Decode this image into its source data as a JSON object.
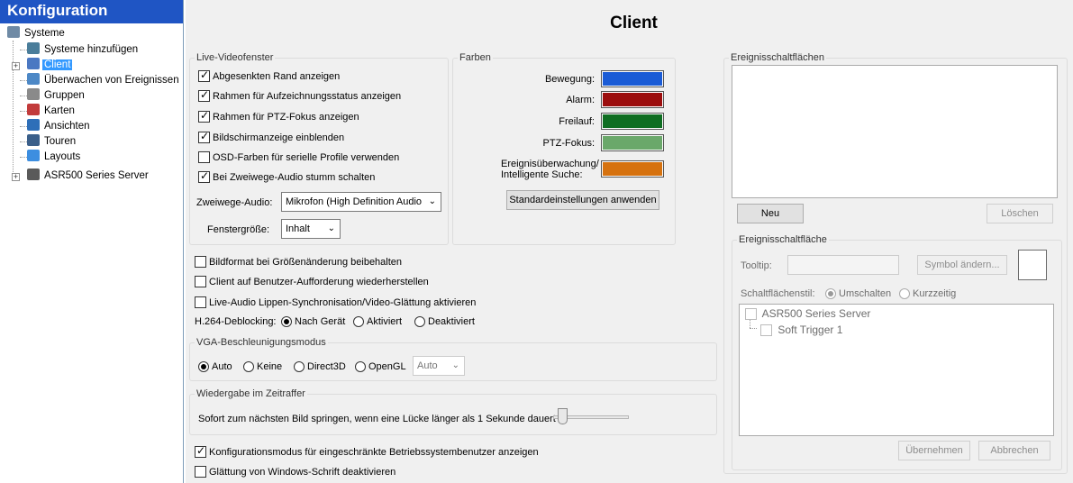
{
  "sidebar": {
    "title": "Konfiguration",
    "items": [
      {
        "label": "Systeme",
        "icon": "server-icon",
        "color": "#6f8aa5"
      },
      {
        "label": "Systeme hinzufügen",
        "icon": "add-system-icon",
        "color": "#4a7d9a"
      },
      {
        "label": "Client",
        "icon": "client-gear-icon",
        "color": "#4b78c2",
        "selected": true
      },
      {
        "label": "Überwachen von Ereignissen",
        "icon": "event-monitor-icon",
        "color": "#4d88c6"
      },
      {
        "label": "Gruppen",
        "icon": "groups-icon",
        "color": "#8a8a8a"
      },
      {
        "label": "Karten",
        "icon": "maps-icon",
        "color": "#c23b3b"
      },
      {
        "label": "Ansichten",
        "icon": "views-icon",
        "color": "#2e6fb8"
      },
      {
        "label": "Touren",
        "icon": "tours-icon",
        "color": "#3a5f8a"
      },
      {
        "label": "Layouts",
        "icon": "layouts-icon",
        "color": "#3d8ee0"
      },
      {
        "label": "ASR500 Series Server",
        "icon": "asr-server-icon",
        "color": "#5a5a5a"
      }
    ],
    "selected_color": "#3399ff",
    "header_color": "#1f55c4"
  },
  "main": {
    "title": "Client",
    "live": {
      "title": "Live-Videofenster",
      "checkboxes": [
        {
          "label": "Abgesenkten Rand anzeigen",
          "checked": true
        },
        {
          "label": "Rahmen für Aufzeichnungsstatus anzeigen",
          "checked": true
        },
        {
          "label": "Rahmen für PTZ-Fokus anzeigen",
          "checked": true
        },
        {
          "label": "Bildschirmanzeige einblenden",
          "checked": true
        },
        {
          "label": "OSD-Farben für serielle Profile verwenden",
          "checked": false
        },
        {
          "label": "Bei Zweiwege-Audio stumm schalten",
          "checked": true
        }
      ],
      "audio_label": "Zweiwege-Audio:",
      "audio_value": "Mikrofon (High Definition Audio",
      "size_label": "Fenstergröße:",
      "size_value": "Inhalt"
    },
    "colors": {
      "title": "Farben",
      "items": [
        {
          "label": "Bewegung:",
          "color": "#1a5bd6"
        },
        {
          "label": "Alarm:",
          "color": "#9c0d0d"
        },
        {
          "label": "Freilauf:",
          "color": "#0f6e22"
        },
        {
          "label": "PTZ-Fokus:",
          "color": "#6aa86a"
        },
        {
          "label1": "Ereignisüberwachung/",
          "label2": "Intelligente Suche:",
          "color": "#d6720f"
        }
      ],
      "default_button": "Standardeinstellungen anwenden"
    },
    "options": [
      {
        "label": "Bildformat bei Größenänderung beibehalten",
        "checked": false
      },
      {
        "label": "Client auf Benutzer-Aufforderung wiederherstellen",
        "checked": false
      },
      {
        "label": "Live-Audio Lippen-Synchronisation/Video-Glättung aktivieren",
        "checked": false
      }
    ],
    "deblocking": {
      "label": "H.264-Deblocking:",
      "options": [
        "Nach Gerät",
        "Aktiviert",
        "Deaktiviert"
      ],
      "selected": 0
    },
    "vga": {
      "title": "VGA-Beschleunigungsmodus",
      "options": [
        "Auto",
        "Keine",
        "Direct3D",
        "OpenGL"
      ],
      "selected": 0,
      "select_value": "Auto"
    },
    "timelapse": {
      "title": "Wiedergabe im Zeitraffer",
      "text": "Sofort zum nächsten Bild springen, wenn eine Lücke länger als 1 Sekunde dauert",
      "slider_value": 0
    },
    "bottom_options": [
      {
        "label": "Konfigurationsmodus für eingeschränkte Betriebssystembenutzer anzeigen",
        "checked": true
      },
      {
        "label": "Glättung von Windows-Schrift deaktivieren",
        "checked": false
      }
    ],
    "events": {
      "title": "Ereignisschaltflächen",
      "new_button": "Neu",
      "delete_button": "Löschen",
      "sub_title": "Ereignisschaltfläche",
      "tooltip_label": "Tooltip:",
      "tooltip_value": "",
      "change_symbol_button": "Symbol ändern...",
      "style_label": "Schaltflächenstil:",
      "style_options": [
        "Umschalten",
        "Kurzzeitig"
      ],
      "style_selected": 0,
      "tree_items": [
        "ASR500 Series Server",
        "Soft Trigger 1"
      ],
      "apply_button": "Übernehmen",
      "cancel_button": "Abbrechen"
    }
  }
}
